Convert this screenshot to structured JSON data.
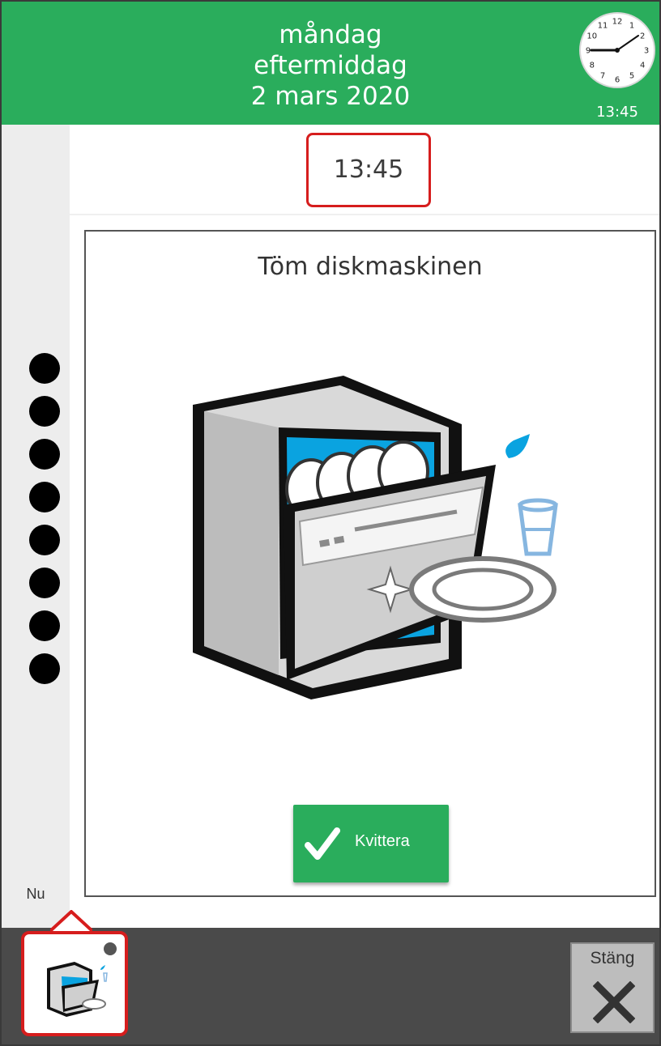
{
  "header": {
    "weekday": "måndag",
    "part_of_day": "eftermiddag",
    "date": "2 mars 2020",
    "clock_time": "13:45",
    "clock_numbers": [
      "12",
      "1",
      "2",
      "3",
      "4",
      "5",
      "6",
      "7",
      "8",
      "9",
      "10",
      "11"
    ]
  },
  "activity": {
    "time": "13:45",
    "title": "Töm diskmaskinen",
    "icon": "dishwasher-icon",
    "ack_label": "Kvittera"
  },
  "timeline": {
    "now_label": "Nu",
    "dot_count": 8
  },
  "bottom": {
    "close_label": "Stäng"
  },
  "colors": {
    "header_green": "#2aad5c",
    "highlight_red": "#d61d1d",
    "bottom_bar": "#4a4a4a",
    "dishwasher_blue": "#0aa3e0"
  }
}
